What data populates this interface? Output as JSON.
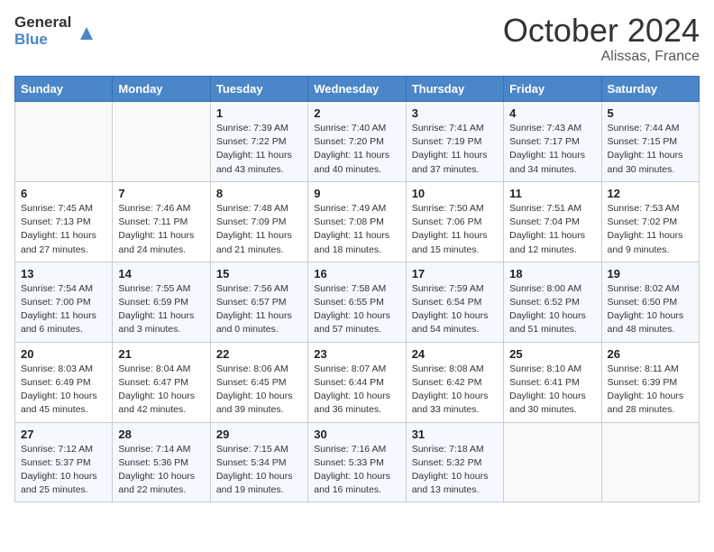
{
  "header": {
    "logo_general": "General",
    "logo_blue": "Blue",
    "month": "October 2024",
    "location": "Alissas, France"
  },
  "days_of_week": [
    "Sunday",
    "Monday",
    "Tuesday",
    "Wednesday",
    "Thursday",
    "Friday",
    "Saturday"
  ],
  "weeks": [
    [
      {
        "day": "",
        "info": ""
      },
      {
        "day": "",
        "info": ""
      },
      {
        "day": "1",
        "info": "Sunrise: 7:39 AM\nSunset: 7:22 PM\nDaylight: 11 hours and 43 minutes."
      },
      {
        "day": "2",
        "info": "Sunrise: 7:40 AM\nSunset: 7:20 PM\nDaylight: 11 hours and 40 minutes."
      },
      {
        "day": "3",
        "info": "Sunrise: 7:41 AM\nSunset: 7:19 PM\nDaylight: 11 hours and 37 minutes."
      },
      {
        "day": "4",
        "info": "Sunrise: 7:43 AM\nSunset: 7:17 PM\nDaylight: 11 hours and 34 minutes."
      },
      {
        "day": "5",
        "info": "Sunrise: 7:44 AM\nSunset: 7:15 PM\nDaylight: 11 hours and 30 minutes."
      }
    ],
    [
      {
        "day": "6",
        "info": "Sunrise: 7:45 AM\nSunset: 7:13 PM\nDaylight: 11 hours and 27 minutes."
      },
      {
        "day": "7",
        "info": "Sunrise: 7:46 AM\nSunset: 7:11 PM\nDaylight: 11 hours and 24 minutes."
      },
      {
        "day": "8",
        "info": "Sunrise: 7:48 AM\nSunset: 7:09 PM\nDaylight: 11 hours and 21 minutes."
      },
      {
        "day": "9",
        "info": "Sunrise: 7:49 AM\nSunset: 7:08 PM\nDaylight: 11 hours and 18 minutes."
      },
      {
        "day": "10",
        "info": "Sunrise: 7:50 AM\nSunset: 7:06 PM\nDaylight: 11 hours and 15 minutes."
      },
      {
        "day": "11",
        "info": "Sunrise: 7:51 AM\nSunset: 7:04 PM\nDaylight: 11 hours and 12 minutes."
      },
      {
        "day": "12",
        "info": "Sunrise: 7:53 AM\nSunset: 7:02 PM\nDaylight: 11 hours and 9 minutes."
      }
    ],
    [
      {
        "day": "13",
        "info": "Sunrise: 7:54 AM\nSunset: 7:00 PM\nDaylight: 11 hours and 6 minutes."
      },
      {
        "day": "14",
        "info": "Sunrise: 7:55 AM\nSunset: 6:59 PM\nDaylight: 11 hours and 3 minutes."
      },
      {
        "day": "15",
        "info": "Sunrise: 7:56 AM\nSunset: 6:57 PM\nDaylight: 11 hours and 0 minutes."
      },
      {
        "day": "16",
        "info": "Sunrise: 7:58 AM\nSunset: 6:55 PM\nDaylight: 10 hours and 57 minutes."
      },
      {
        "day": "17",
        "info": "Sunrise: 7:59 AM\nSunset: 6:54 PM\nDaylight: 10 hours and 54 minutes."
      },
      {
        "day": "18",
        "info": "Sunrise: 8:00 AM\nSunset: 6:52 PM\nDaylight: 10 hours and 51 minutes."
      },
      {
        "day": "19",
        "info": "Sunrise: 8:02 AM\nSunset: 6:50 PM\nDaylight: 10 hours and 48 minutes."
      }
    ],
    [
      {
        "day": "20",
        "info": "Sunrise: 8:03 AM\nSunset: 6:49 PM\nDaylight: 10 hours and 45 minutes."
      },
      {
        "day": "21",
        "info": "Sunrise: 8:04 AM\nSunset: 6:47 PM\nDaylight: 10 hours and 42 minutes."
      },
      {
        "day": "22",
        "info": "Sunrise: 8:06 AM\nSunset: 6:45 PM\nDaylight: 10 hours and 39 minutes."
      },
      {
        "day": "23",
        "info": "Sunrise: 8:07 AM\nSunset: 6:44 PM\nDaylight: 10 hours and 36 minutes."
      },
      {
        "day": "24",
        "info": "Sunrise: 8:08 AM\nSunset: 6:42 PM\nDaylight: 10 hours and 33 minutes."
      },
      {
        "day": "25",
        "info": "Sunrise: 8:10 AM\nSunset: 6:41 PM\nDaylight: 10 hours and 30 minutes."
      },
      {
        "day": "26",
        "info": "Sunrise: 8:11 AM\nSunset: 6:39 PM\nDaylight: 10 hours and 28 minutes."
      }
    ],
    [
      {
        "day": "27",
        "info": "Sunrise: 7:12 AM\nSunset: 5:37 PM\nDaylight: 10 hours and 25 minutes."
      },
      {
        "day": "28",
        "info": "Sunrise: 7:14 AM\nSunset: 5:36 PM\nDaylight: 10 hours and 22 minutes."
      },
      {
        "day": "29",
        "info": "Sunrise: 7:15 AM\nSunset: 5:34 PM\nDaylight: 10 hours and 19 minutes."
      },
      {
        "day": "30",
        "info": "Sunrise: 7:16 AM\nSunset: 5:33 PM\nDaylight: 10 hours and 16 minutes."
      },
      {
        "day": "31",
        "info": "Sunrise: 7:18 AM\nSunset: 5:32 PM\nDaylight: 10 hours and 13 minutes."
      },
      {
        "day": "",
        "info": ""
      },
      {
        "day": "",
        "info": ""
      }
    ]
  ]
}
